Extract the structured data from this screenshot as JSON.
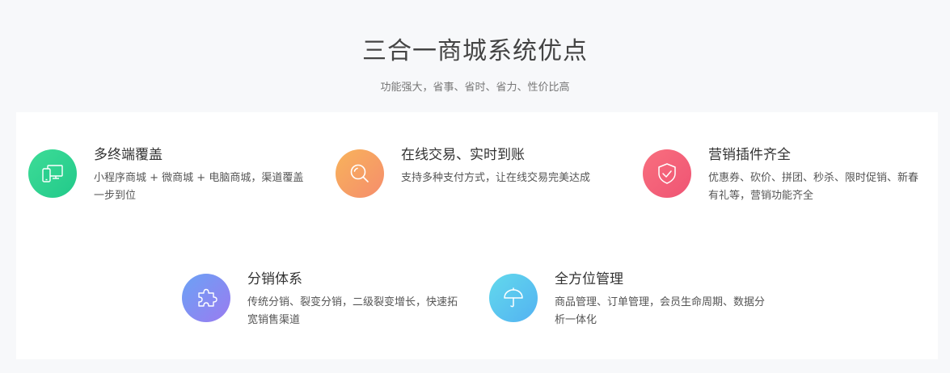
{
  "header": {
    "title": "三合一商城系统优点",
    "subtitle": "功能强大，省事、省时、省力、性价比高"
  },
  "features": [
    {
      "title": "多终端覆盖",
      "desc": "小程序商城 + 微商城 + 电脑商城，渠道覆盖一步到位",
      "icon": "devices-icon",
      "color": "#2fd391"
    },
    {
      "title": "在线交易、实时到账",
      "desc": "支持多种支付方式，让在线交易完美达成",
      "icon": "search-icon",
      "color": "#f7a063"
    },
    {
      "title": "营销插件齐全",
      "desc": "优惠券、砍价、拼团、秒杀、限时促销、新春有礼等，营销功能齐全",
      "icon": "shield-check-icon",
      "color": "#f3607a"
    },
    {
      "title": "分销体系",
      "desc": "传统分销、裂变分销，二级裂变增长，快速拓宽销售渠道",
      "icon": "puzzle-icon",
      "color": "#7e8ef3"
    },
    {
      "title": "全方位管理",
      "desc": "商品管理、订单管理，会员生命周期、数据分析一体化",
      "icon": "umbrella-icon",
      "color": "#5bc6ef"
    }
  ]
}
